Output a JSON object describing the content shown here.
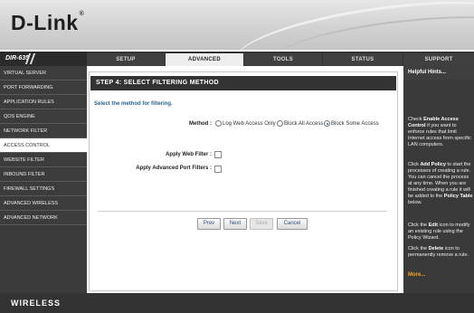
{
  "header": {
    "logo": "D-Link",
    "logo_mark": "®"
  },
  "nav": {
    "model": "DIR-635",
    "tabs": [
      {
        "label": "SETUP"
      },
      {
        "label": "ADVANCED"
      },
      {
        "label": "TOOLS"
      },
      {
        "label": "STATUS"
      },
      {
        "label": "SUPPORT"
      }
    ],
    "active_tab": "ADVANCED"
  },
  "sidebar": {
    "items": [
      {
        "label": "VIRTUAL SERVER"
      },
      {
        "label": "PORT FORWARDING"
      },
      {
        "label": "APPLICATION RULES"
      },
      {
        "label": "QOS ENGINE"
      },
      {
        "label": "NETWORK FILTER"
      },
      {
        "label": "ACCESS CONTROL"
      },
      {
        "label": "WEBSITE FILTER"
      },
      {
        "label": "INBOUND FILTER"
      },
      {
        "label": "FIREWALL SETTINGS"
      },
      {
        "label": "ADVANCED WIRELESS"
      },
      {
        "label": "ADVANCED NETWORK"
      }
    ],
    "active_item": "ACCESS CONTROL"
  },
  "main": {
    "step_title": "STEP 4: SELECT FILTERING METHOD",
    "instruction": "Select the method for filtering.",
    "method_label": "Method :",
    "method_options": [
      {
        "label": "Log Web Access Only",
        "checked": false
      },
      {
        "label": "Block All Access",
        "checked": false
      },
      {
        "label": "Block Some Access",
        "checked": true
      }
    ],
    "web_filter_label": "Apply Web Filter :",
    "web_filter_checked": false,
    "port_filter_label": "Apply Advanced Port Filters :",
    "port_filter_checked": false,
    "buttons": {
      "prev": "Prev",
      "next": "Next",
      "save": "Save",
      "cancel": "Cancel"
    }
  },
  "hints": {
    "title": "Helpful Hints...",
    "h1_pre": "Check ",
    "h1_bold": "Enable Access Control",
    "h1_post": " if you want to enforce rules that limit Internet access from specific LAN computers.",
    "h2_pre": "Click ",
    "h2_bold": "Add Policy",
    "h2_mid": " to start the processes of creating a rule. You can cancel the process at any time. When you are finished creating a rule it will be added to the ",
    "h2_bold2": "Policy Table",
    "h2_post": " below.",
    "h3_pre": "Click the ",
    "h3_bold": "Edit",
    "h3_post": " icon to modify an existing rule using the Policy Wizard.",
    "h4_pre": "Click the ",
    "h4_bold": "Delete",
    "h4_post": " icon to permanently remove a rule.",
    "more": "More..."
  },
  "footer": {
    "label": "WIRELESS"
  }
}
